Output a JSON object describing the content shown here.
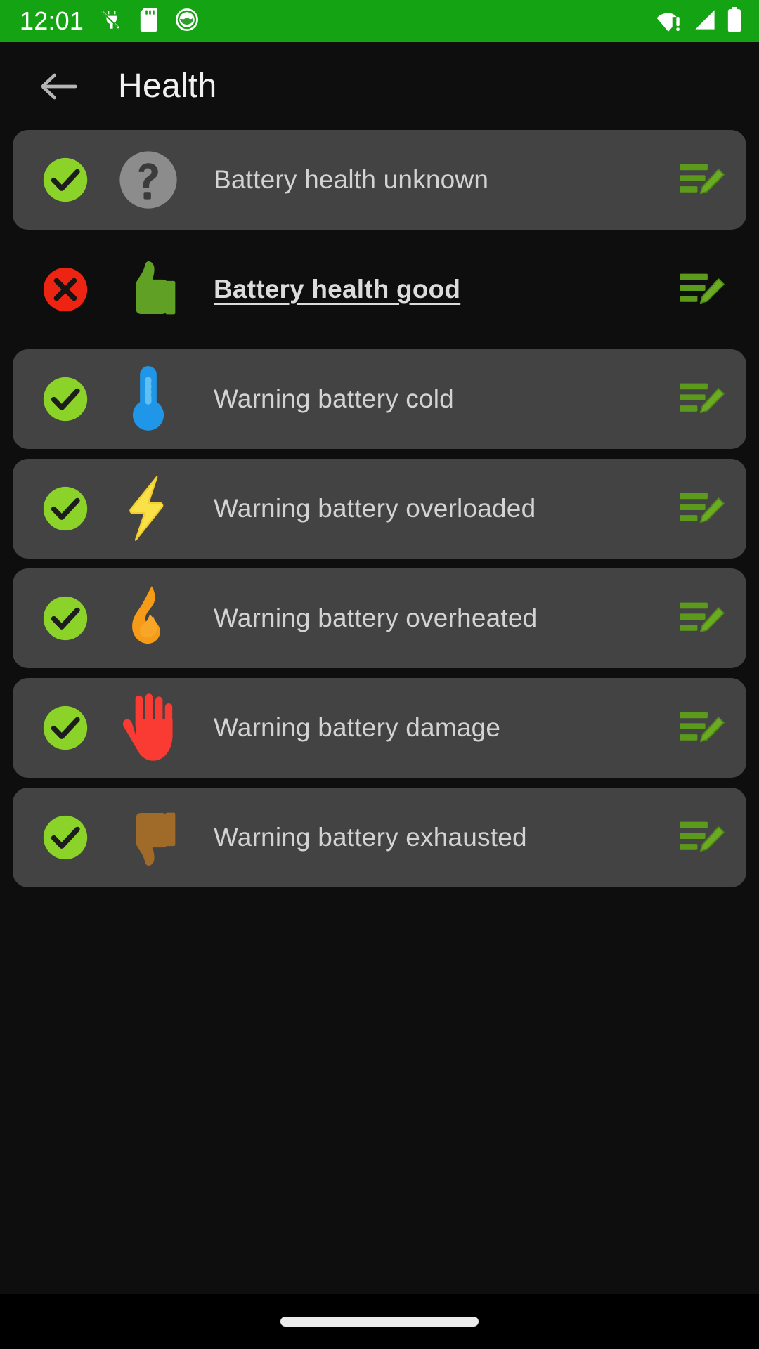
{
  "statusbar": {
    "time": "12:01",
    "background_color": "#14a312",
    "left_icons": [
      {
        "name": "charging-disabled-icon",
        "label": "not charging"
      },
      {
        "name": "sd-card-icon",
        "label": "SD card"
      },
      {
        "name": "app-notification-icon",
        "label": "battery app notification"
      }
    ],
    "right_icons": [
      {
        "name": "wifi-no-internet-icon",
        "label": "Wi-Fi no internet"
      },
      {
        "name": "cellular-signal-icon",
        "label": "mobile signal"
      },
      {
        "name": "battery-full-icon",
        "label": "battery"
      }
    ]
  },
  "appbar": {
    "back_label": "Back",
    "title": "Health"
  },
  "colors": {
    "accent_green": "#8bd329",
    "card_bg": "#434343",
    "page_bg": "#0e0e0e",
    "text": "#d3d3d3",
    "error_red": "#ee2412",
    "edit_green": "#5c9a1c"
  },
  "list": {
    "items": [
      {
        "id": "battery-health-unknown",
        "label": "Battery health unknown",
        "status": "enabled",
        "status_icon": "check-circle-icon",
        "type_icon": "question-mark-icon",
        "card": true,
        "underlined": false,
        "edit_label": "Edit"
      },
      {
        "id": "battery-health-good",
        "label": "Battery health good",
        "status": "disabled",
        "status_icon": "x-circle-icon",
        "type_icon": "thumbs-up-icon",
        "card": false,
        "underlined": true,
        "edit_label": "Edit"
      },
      {
        "id": "warning-battery-cold",
        "label": "Warning battery cold",
        "status": "enabled",
        "status_icon": "check-circle-icon",
        "type_icon": "thermometer-icon",
        "card": true,
        "underlined": false,
        "edit_label": "Edit"
      },
      {
        "id": "warning-battery-overloaded",
        "label": "Warning battery overloaded",
        "status": "enabled",
        "status_icon": "check-circle-icon",
        "type_icon": "lightning-bolt-icon",
        "card": true,
        "underlined": false,
        "edit_label": "Edit"
      },
      {
        "id": "warning-battery-overheated",
        "label": "Warning battery overheated",
        "status": "enabled",
        "status_icon": "check-circle-icon",
        "type_icon": "flame-icon",
        "card": true,
        "underlined": false,
        "edit_label": "Edit"
      },
      {
        "id": "warning-battery-damage",
        "label": "Warning battery damage",
        "status": "enabled",
        "status_icon": "check-circle-icon",
        "type_icon": "raised-hand-icon",
        "card": true,
        "underlined": false,
        "edit_label": "Edit"
      },
      {
        "id": "warning-battery-exhausted",
        "label": "Warning battery exhausted",
        "status": "enabled",
        "status_icon": "check-circle-icon",
        "type_icon": "thumbs-down-icon",
        "card": true,
        "underlined": false,
        "edit_label": "Edit"
      }
    ]
  },
  "navbar": {
    "home_gesture_label": "Home"
  }
}
